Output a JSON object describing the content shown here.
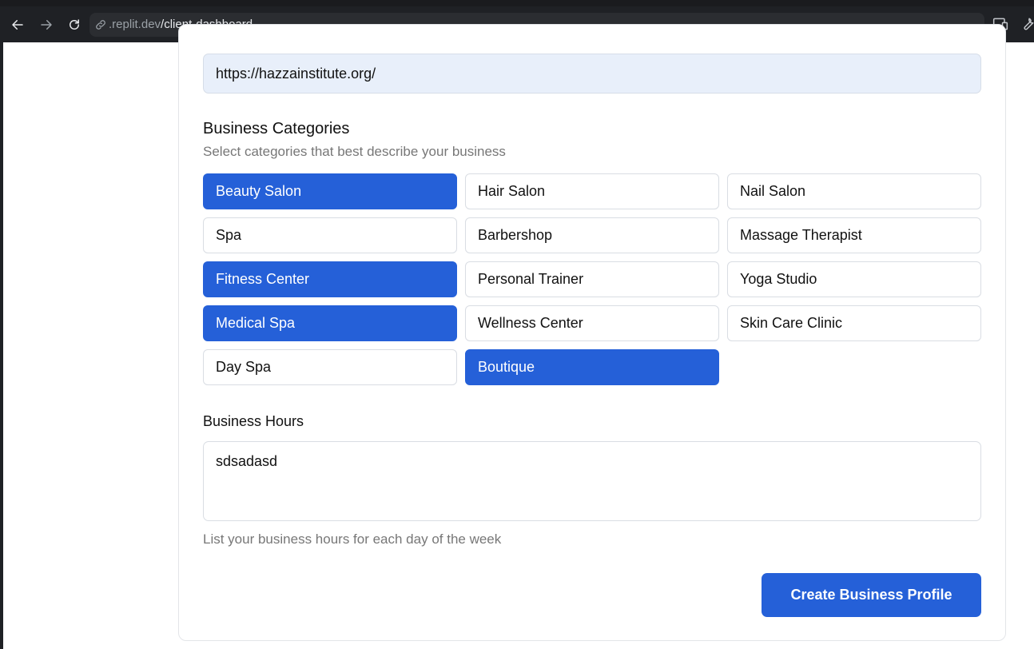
{
  "browser": {
    "url_host": ".replit.dev",
    "url_path": "/client-dashboard",
    "icons": [
      "back-arrow-icon",
      "forward-arrow-icon",
      "reload-icon",
      "link-icon",
      "devices-icon",
      "wrench-icon"
    ]
  },
  "website_field": {
    "value": "https://hazzainstitute.org/"
  },
  "categories_section": {
    "title": "Business Categories",
    "subtitle": "Select categories that best describe your business",
    "items": [
      {
        "label": "Beauty Salon",
        "selected": true
      },
      {
        "label": "Hair Salon",
        "selected": false
      },
      {
        "label": "Nail Salon",
        "selected": false
      },
      {
        "label": "Spa",
        "selected": false
      },
      {
        "label": "Barbershop",
        "selected": false
      },
      {
        "label": "Massage Therapist",
        "selected": false
      },
      {
        "label": "Fitness Center",
        "selected": true
      },
      {
        "label": "Personal Trainer",
        "selected": false
      },
      {
        "label": "Yoga Studio",
        "selected": false
      },
      {
        "label": "Medical Spa",
        "selected": true
      },
      {
        "label": "Wellness Center",
        "selected": false
      },
      {
        "label": "Skin Care Clinic",
        "selected": false
      },
      {
        "label": "Day Spa",
        "selected": false
      },
      {
        "label": "Boutique",
        "selected": true
      }
    ]
  },
  "hours_section": {
    "label": "Business Hours",
    "value": "sdsadasd",
    "help": "List your business hours for each day of the week"
  },
  "submit_label": "Create Business Profile",
  "colors": {
    "accent": "#2560d8",
    "chrome_bg": "#1f2125",
    "field_bg": "#e8effa"
  }
}
